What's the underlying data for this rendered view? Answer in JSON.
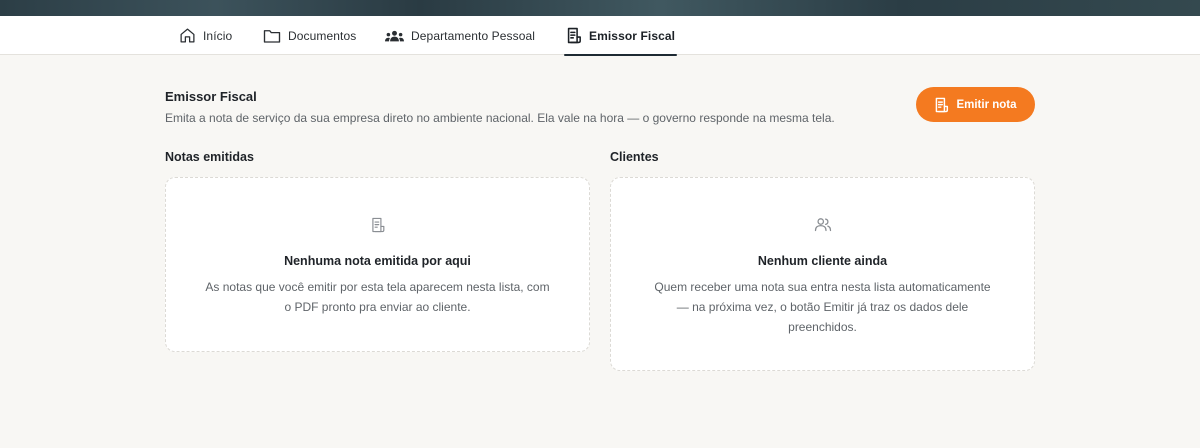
{
  "nav": {
    "tabs": [
      {
        "label": "Início",
        "icon": "home-icon"
      },
      {
        "label": "Documentos",
        "icon": "folder-icon"
      },
      {
        "label": "Departamento Pessoal",
        "icon": "users-icon"
      },
      {
        "label": "Emissor Fiscal",
        "icon": "receipt-icon",
        "active": true
      }
    ]
  },
  "header": {
    "title": "Emissor Fiscal",
    "description": "Emita a nota de serviço da sua empresa direto no ambiente nacional. Ela vale na hora — o governo responde na mesma tela.",
    "emit_button": "Emitir nota"
  },
  "notas": {
    "section_title": "Notas emitidas",
    "empty_title": "Nenhuma nota emitida por aqui",
    "empty_text": "As notas que você emitir por esta tela aparecem nesta lista, com o PDF pronto pra enviar ao cliente."
  },
  "clientes": {
    "section_title": "Clientes",
    "empty_title": "Nenhum cliente ainda",
    "empty_text": "Quem receber uma nota sua entra nesta lista automaticamente — na próxima vez, o botão Emitir já traz os dados dele preenchidos."
  },
  "colors": {
    "accent": "#f47a20",
    "background": "#f8f7f4",
    "active_underline": "#1e2a33"
  }
}
